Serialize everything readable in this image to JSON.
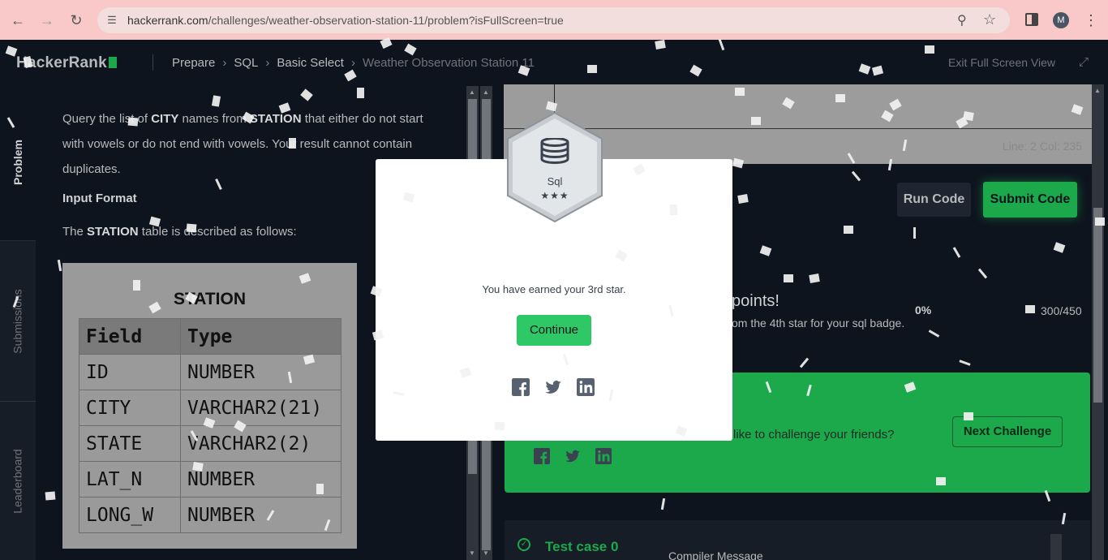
{
  "browser": {
    "url_main": "hackerrank.com",
    "url_path": "/challenges/weather-observation-station-11/problem?isFullScreen=true",
    "profile_initial": "M"
  },
  "header": {
    "logo": "HackerRank",
    "breadcrumbs": [
      "Prepare",
      "SQL",
      "Basic Select",
      "Weather Observation Station 11"
    ],
    "exit_fullscreen": "Exit Full Screen View"
  },
  "tabs": [
    "Problem",
    "Submissions",
    "Leaderboard"
  ],
  "problem": {
    "text_start": "Query the list of ",
    "text_city": "CITY",
    "text_mid": " names from ",
    "text_station": "STATION",
    "text_end": " that either do not start with vowels or do not end with vowels. Your result cannot contain duplicates.",
    "input_heading": "Input Format",
    "desc_start": "The ",
    "desc_station": "STATION",
    "desc_end": " table is described as follows:",
    "table_title": "STATION",
    "table_headers": [
      "Field",
      "Type"
    ],
    "table_rows": [
      [
        "ID",
        "NUMBER"
      ],
      [
        "CITY",
        "VARCHAR2(21)"
      ],
      [
        "STATE",
        "VARCHAR2(2)"
      ],
      [
        "LAT_N",
        "NUMBER"
      ],
      [
        "LONG_W",
        "NUMBER"
      ]
    ]
  },
  "editor": {
    "status": "Line: 2 Col: 235",
    "run_label": "Run Code",
    "submit_label": "Submit Code",
    "points_text": "points!",
    "star_text": "om the 4th star for your sql badge.",
    "percent": "0%",
    "score": "300/450",
    "challenge_text": "like to challenge your friends?",
    "next_challenge": "Next Challenge",
    "testcase_label": "Test case 0",
    "compiler_label": "Compiler Message"
  },
  "modal": {
    "badge_name": "Sql",
    "badge_stars": "★★★",
    "message": "You have earned your 3rd star.",
    "continue_label": "Continue"
  },
  "colors": {
    "accent_green": "#1ba94c",
    "button_green": "#2ec866",
    "background": "#0e141e"
  }
}
